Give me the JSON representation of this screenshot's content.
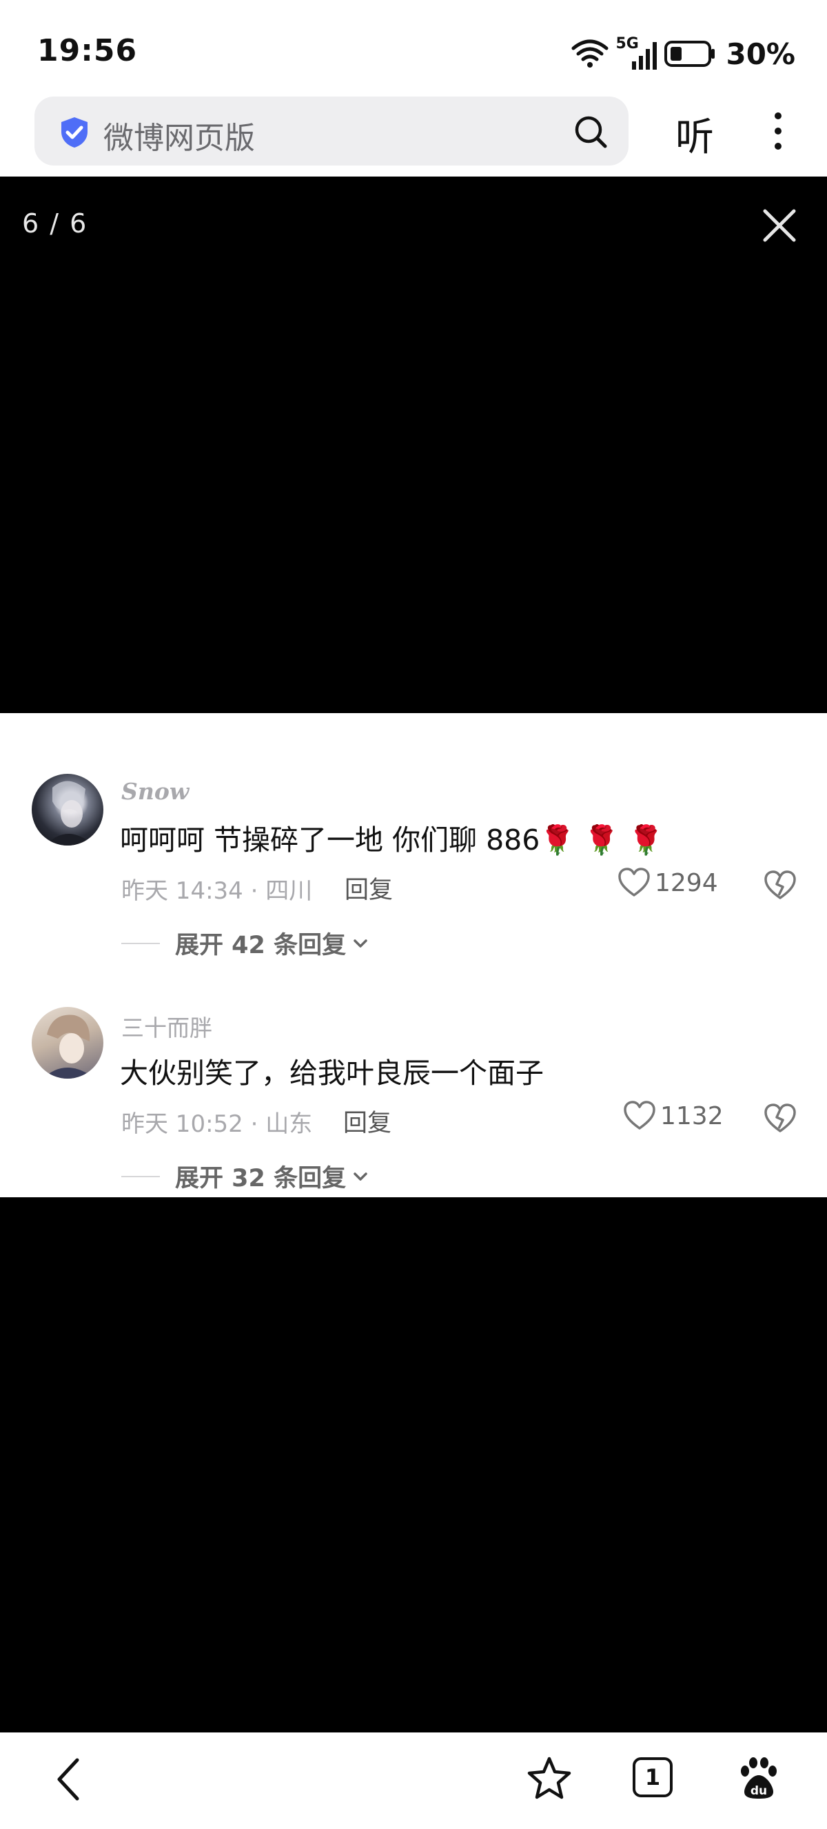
{
  "status_bar": {
    "time": "19:56",
    "network": "5G",
    "battery": "30%"
  },
  "browser": {
    "address_text": "微博网页版",
    "listen_label": "听"
  },
  "viewer": {
    "counter": "6 / 6"
  },
  "comments": [
    {
      "username": "Snow",
      "text": "呵呵呵 节操碎了一地 你们聊 886🌹 🌹 🌹",
      "meta": "昨天 14:34 · 四川",
      "reply_label": "回复",
      "likes": "1294",
      "expand_label": "展开 42 条回复"
    },
    {
      "username": "三十而胖",
      "text": "大伙别笑了，给我叶良辰一个面子",
      "meta": "昨天 10:52 · 山东",
      "reply_label": "回复",
      "likes": "1132",
      "expand_label": "展开 32 条回复"
    }
  ],
  "bottom_nav": {
    "tab_count": "1"
  },
  "colors": {
    "accent_blue": "#4f6ef7",
    "muted_text": "#a8a8ac"
  }
}
